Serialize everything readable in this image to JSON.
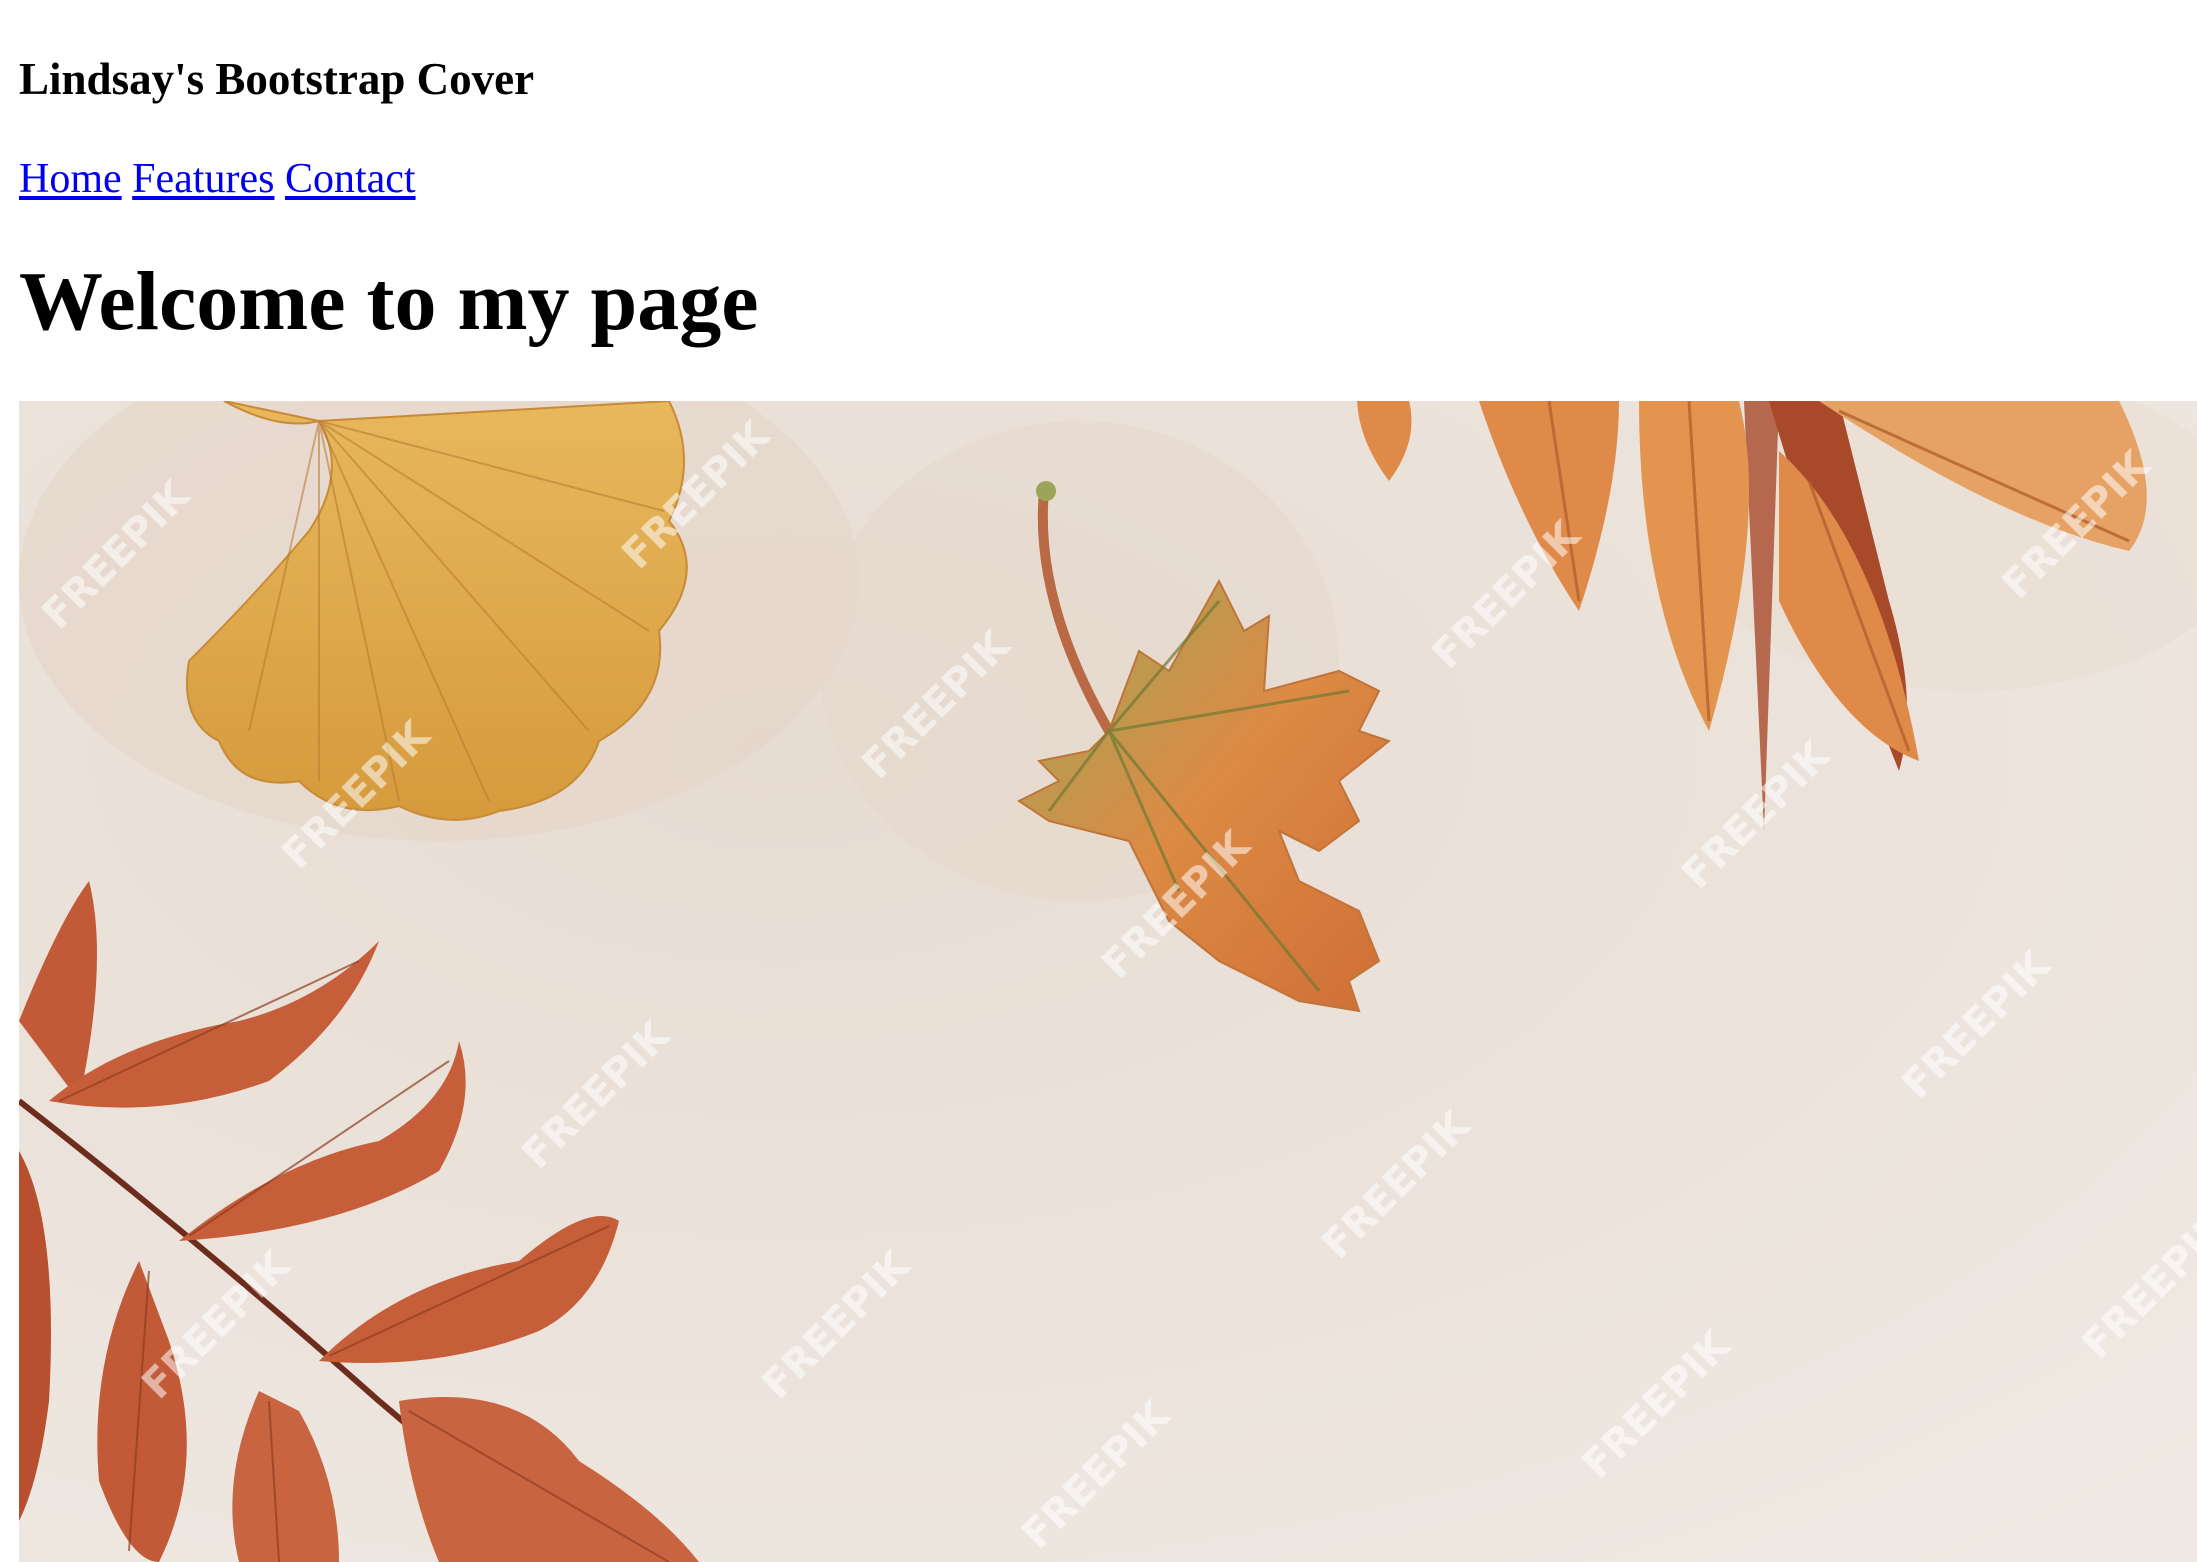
{
  "header": {
    "site_title": "Lindsay's Bootstrap Cover"
  },
  "nav": {
    "links": [
      {
        "label": "Home"
      },
      {
        "label": "Features"
      },
      {
        "label": "Contact"
      }
    ]
  },
  "main": {
    "heading": "Welcome to my page"
  },
  "hero_image": {
    "watermark": "FREEPIK",
    "colors": {
      "background": "#ede6df",
      "ginkgo": "#dca64a",
      "maple": "#d9823f",
      "rust_leaves": "#c25a37",
      "orange_leaves": "#e08a4a",
      "stem": "#7a3a24"
    }
  },
  "colors": {
    "link": "#0000ee",
    "text": "#000000",
    "page_background": "#ffffff"
  }
}
